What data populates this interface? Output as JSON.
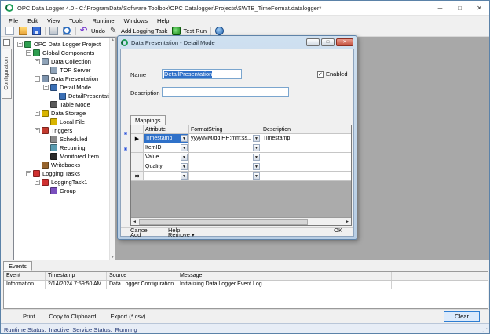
{
  "window": {
    "title": "OPC Data Logger 4.0 - C:\\ProgramData\\Software Toolbox\\OPC Datalogger\\Projects\\SWTB_TimeFormat.datalogger*",
    "minimize": "─",
    "maximize": "□",
    "close": "✕"
  },
  "menu": {
    "items": [
      "File",
      "Edit",
      "View",
      "Tools",
      "Runtime",
      "Windows",
      "Help"
    ]
  },
  "toolbar": {
    "undo_label": "Undo",
    "add_logging_task_label": "Add Logging Task",
    "test_run_label": "Test Run",
    "undo_glyph": "↶",
    "pencil_glyph": "✎"
  },
  "sidebar": {
    "tab_label": "Configuration",
    "tree": [
      {
        "label": "OPC Data Logger Project",
        "level": 0,
        "expanded": true,
        "icon": "project-icon",
        "color": "#2e9e4f"
      },
      {
        "label": "Global Components",
        "level": 1,
        "expanded": true,
        "icon": "global-components-icon",
        "color": "#2e9e4f"
      },
      {
        "label": "Data Collection",
        "level": 2,
        "expanded": true,
        "icon": "data-collection-icon",
        "color": "#8fa3b8"
      },
      {
        "label": "TOP Server",
        "level": 3,
        "expanded": null,
        "icon": "top-server-icon",
        "color": "#8fa3b8"
      },
      {
        "label": "Data Presentation",
        "level": 2,
        "expanded": true,
        "icon": "data-presentation-icon",
        "color": "#7d93ad"
      },
      {
        "label": "Detail Mode",
        "level": 3,
        "expanded": true,
        "icon": "detail-mode-icon",
        "color": "#3a6fb5"
      },
      {
        "label": "DetailPresentation",
        "level": 4,
        "expanded": null,
        "icon": "detail-presentation-icon",
        "color": "#3a6fb5"
      },
      {
        "label": "Table Mode",
        "level": 3,
        "expanded": null,
        "icon": "table-mode-icon",
        "color": "#5a5a5a"
      },
      {
        "label": "Data Storage",
        "level": 2,
        "expanded": true,
        "icon": "data-storage-icon",
        "color": "#d8b400"
      },
      {
        "label": "Local File",
        "level": 3,
        "expanded": null,
        "icon": "local-file-icon",
        "color": "#d8b400"
      },
      {
        "label": "Triggers",
        "level": 2,
        "expanded": true,
        "icon": "triggers-icon",
        "color": "#c23a2e"
      },
      {
        "label": "Scheduled",
        "level": 3,
        "expanded": null,
        "icon": "scheduled-icon",
        "color": "#8a8a8a"
      },
      {
        "label": "Recurring",
        "level": 3,
        "expanded": null,
        "icon": "recurring-icon",
        "color": "#5a9bb0"
      },
      {
        "label": "Monitored Item",
        "level": 3,
        "expanded": null,
        "icon": "monitored-item-icon",
        "color": "#2a2a2a"
      },
      {
        "label": "Writebacks",
        "level": 2,
        "expanded": null,
        "icon": "writebacks-icon",
        "color": "#96642d"
      },
      {
        "label": "Logging Tasks",
        "level": 1,
        "expanded": true,
        "icon": "logging-tasks-icon",
        "color": "#cf3030"
      },
      {
        "label": "LoggingTask1",
        "level": 2,
        "expanded": true,
        "icon": "logging-task-icon",
        "color": "#cf3030"
      },
      {
        "label": "Group",
        "level": 3,
        "expanded": null,
        "icon": "group-icon",
        "color": "#7a4fbe"
      }
    ]
  },
  "dialog": {
    "title": "Data Presentation - Detail Mode",
    "minimize": "─",
    "maximize": "□",
    "close": "✕",
    "name_label": "Name",
    "name_value": "DetailPresentation",
    "enabled_label": "Enabled",
    "enabled_checked": "✓",
    "description_label": "Description",
    "description_value": "",
    "tab_label": "Mappings",
    "grid": {
      "columns": [
        "Attribute",
        "FormatString",
        "Description"
      ],
      "rows": [
        {
          "marker": "▶",
          "attribute": "Timestamp",
          "format": "yyyy/MM/dd HH:mm:ss...",
          "description": "Timestamp",
          "selected": true
        },
        {
          "marker": "",
          "attribute": "ItemID",
          "format": "",
          "description": "",
          "selected": false
        },
        {
          "marker": "",
          "attribute": "Value",
          "format": "",
          "description": "",
          "selected": false
        },
        {
          "marker": "",
          "attribute": "Quality",
          "format": "",
          "description": "",
          "selected": false
        },
        {
          "marker": "✱",
          "attribute": "",
          "format": "",
          "description": "",
          "selected": false
        }
      ]
    },
    "add_label": "Add",
    "remove_label": "Remove",
    "remove_arrow": "▾",
    "cancel_label": "Cancel",
    "help_label": "Help",
    "ok_label": "OK"
  },
  "events": {
    "tab_label": "Events",
    "columns": [
      "Event",
      "Timestamp",
      "Source",
      "Message"
    ],
    "rows": [
      [
        "Information",
        "2/14/2024 7:59:50 AM",
        "Data Logger Configuration",
        "Initializing Data Logger Event Log"
      ]
    ],
    "print_label": "Print",
    "copy_label": "Copy to Clipboard",
    "export_label": "Export (*.csv)",
    "clear_label": "Clear"
  },
  "statusbar": {
    "runtime_label": "Runtime Status:",
    "runtime_value": "Inactive",
    "service_label": "Service Status:",
    "service_value": "Running"
  },
  "colors": {
    "selection_blue": "#2f71c9",
    "mdi_gray": "#a8a8a8",
    "status_navy": "#1f3470",
    "clear_button_border": "#2d7dd2"
  }
}
